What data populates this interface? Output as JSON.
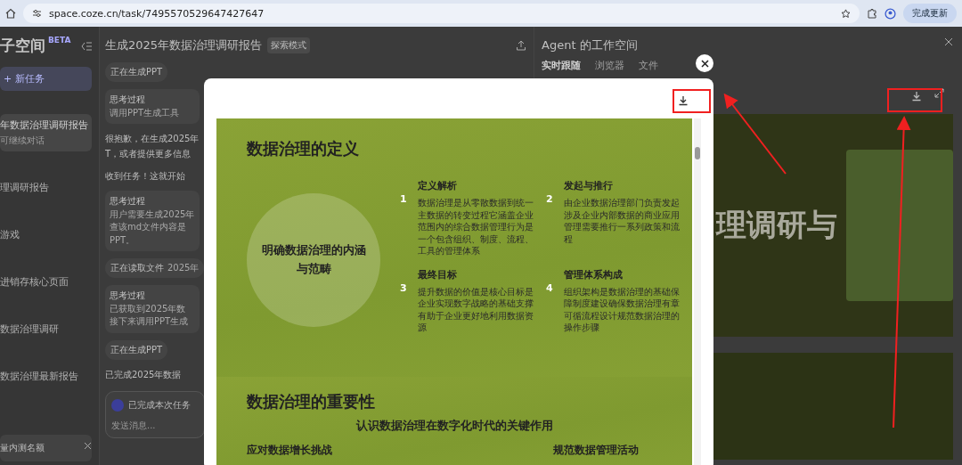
{
  "browser": {
    "url": "space.coze.cn/task/7495570529647427647",
    "update_button": "完成更新"
  },
  "sidebar": {
    "title": "子空间",
    "badge": "BETA",
    "new_task": "+ 新任务",
    "tasks": [
      {
        "title": "年数据治理调研报告",
        "subtitle": "可继续对话",
        "selected": true
      },
      {
        "title": "理调研报告",
        "selected": false
      },
      {
        "title": "游戏",
        "selected": false
      },
      {
        "title": "进销存核心页面",
        "selected": false
      },
      {
        "title": "数据治理调研",
        "selected": false
      },
      {
        "title": "数据治理最新报告",
        "selected": false
      }
    ],
    "promo": {
      "text": "量内测名额"
    }
  },
  "chat": {
    "title": "生成2025年数据治理调研报告",
    "mode_badge": "探索模式",
    "messages": [
      {
        "kind": "status",
        "text": "正在生成PPT"
      },
      {
        "kind": "thinking",
        "label": "思考过程",
        "lines": [
          "调用PPT生成工具"
        ]
      },
      {
        "kind": "text",
        "lines": [
          "很抱歉，在生成2025年",
          "T，或者提供更多信息"
        ]
      },
      {
        "kind": "text",
        "lines": [
          "收到任务！这就开始"
        ]
      },
      {
        "kind": "thinking",
        "label": "思考过程",
        "lines": [
          "用户需要生成2025年",
          "查该md文件内容是",
          "PPT。"
        ]
      },
      {
        "kind": "status",
        "text": "正在读取文件",
        "detail": "2025年"
      },
      {
        "kind": "thinking",
        "label": "思考过程",
        "lines": [
          "已获取到2025年数",
          "接下来调用PPT生成"
        ]
      },
      {
        "kind": "status",
        "text": "正在生成PPT"
      },
      {
        "kind": "text",
        "lines": [
          "已完成2025年数据"
        ]
      }
    ],
    "composer": {
      "status": "已完成本次任务",
      "placeholder": "发送消息..."
    }
  },
  "workspace": {
    "title": "Agent 的工作空间",
    "tabs": [
      {
        "label": "实时跟随",
        "selected": true
      },
      {
        "label": "浏览器",
        "selected": false
      },
      {
        "label": "文件",
        "selected": false
      }
    ],
    "preview_heading": "理调研与"
  },
  "modal": {
    "slides": [
      {
        "kind": "definition",
        "title": "数据治理的定义",
        "circle_text": "明确数据治理的内涵与范畴",
        "items": [
          {
            "number": "1",
            "heading": "定义解析",
            "body": "数据治理是从零散数据到统一主数据的转变过程它涵盖企业范围内的综合数据管理行为是一个包含组织、制度、流程、工具的管理体系"
          },
          {
            "number": "2",
            "heading": "发起与推行",
            "body": "由企业数据治理部门负责发起涉及企业内部数据的商业应用管理需要推行一系列政策和流程"
          },
          {
            "number": "3",
            "heading": "最终目标",
            "body": "提升数据的价值是核心目标是企业实现数字战略的基础支撑有助于企业更好地利用数据资源"
          },
          {
            "number": "4",
            "heading": "管理体系构成",
            "body": "组织架构是数据治理的基础保障制度建设确保数据治理有章可循流程设计规范数据治理的操作步骤"
          }
        ]
      },
      {
        "kind": "importance",
        "title": "数据治理的重要性",
        "subtitle": "认识数据治理在数字化时代的关键作用",
        "columns": [
          "应对数据增长挑战",
          "规范数据管理活动"
        ]
      }
    ]
  }
}
